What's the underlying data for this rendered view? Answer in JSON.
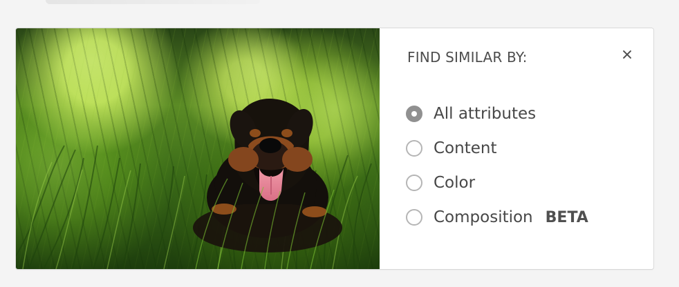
{
  "panel": {
    "title": "FIND SIMILAR BY:",
    "close_icon": "close-icon"
  },
  "options": [
    {
      "label": "All attributes",
      "selected": true
    },
    {
      "label": "Content",
      "selected": false
    },
    {
      "label": "Color",
      "selected": false
    },
    {
      "label": "Composition",
      "selected": false,
      "badge": "BETA"
    }
  ],
  "image": {
    "subject": "dog-in-grass",
    "dominant_color": "#5b8b25"
  }
}
